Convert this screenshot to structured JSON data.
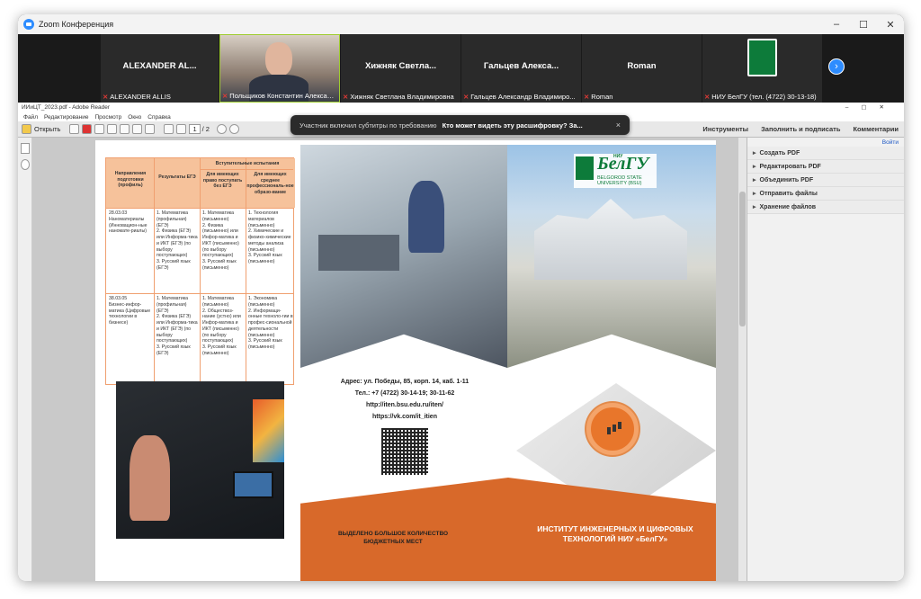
{
  "window": {
    "title": "Zoom Конференция",
    "controls": [
      "–",
      "☐",
      "✕"
    ]
  },
  "participants": [
    {
      "display": "ALEXANDER AL...",
      "caption": "ALEXANDER ALLIS",
      "muted": true
    },
    {
      "display": "",
      "caption": "Польщиков Константин Александр...",
      "muted": true,
      "active": true
    },
    {
      "display": "Хижняк Светла...",
      "caption": "Хижняк Светлана Владимировна",
      "muted": true
    },
    {
      "display": "Гальцев Алекса...",
      "caption": "Гальцев Александр Владимиро...",
      "muted": true
    },
    {
      "display": "Roman",
      "caption": "Roman",
      "muted": true
    },
    {
      "display": "",
      "caption": "НИУ БелГУ (тел. (4722) 30-13-18)",
      "muted": true
    }
  ],
  "toast": {
    "text": "Участник включил субтитры по требованию",
    "question": "Кто может видеть эту расшифровку? За...",
    "close": "×"
  },
  "reader": {
    "title": "ИИиЦТ_2023.pdf - Adobe Reader",
    "menu": [
      "Файл",
      "Редактирование",
      "Просмотр",
      "Окно",
      "Справка"
    ],
    "open_label": "Открыть",
    "page_current": "1",
    "page_total": "/ 2",
    "tools_right": [
      "Инструменты",
      "Заполнить и подписать",
      "Комментарии"
    ],
    "login": "Войти",
    "panel_items": [
      "Создать PDF",
      "Редактировать PDF",
      "Объединить PDF",
      "Отправить файлы",
      "Хранение файлов"
    ]
  },
  "brochure": {
    "table": {
      "h1": "Направления подготовки (профиль)",
      "h2": "Результаты ЕГЭ",
      "h3": "Вступительные испытания",
      "h4": "Для имеющих право поступать без ЕГЭ",
      "h5": "Для имеющих среднее профессиональ-ное образо-вание",
      "r1c1": "28.03.03\nНаноматериалы (Инновацион-ные наномате-риалы)",
      "r1c2": "1. Математика (профильная) (ЕГЭ)\n2. Физика (ЕГЭ) или Информа-тика и ИКТ (ЕГЭ) (по выбору поступающих)\n3. Русский язык (ЕГЭ)",
      "r1c3": "1. Математика (письменно)\n2. Физика (письменно) или Инфор-матика и ИКТ (письменно) (по выбору поступающих)\n3. Русский язык (письменно)",
      "r1c4": "1. Технология материалов (письменно)\n2. Химические и физико-химические методы анализа (письменно)\n3. Русский язык (письменно)",
      "r2c1": "38.03.05\nБизнес-инфор-матика (Цифровые технологии в бизнесе)",
      "r2c2": "1. Математика (профильная) (ЕГЭ)\n2. Физика (ЕГЭ) или Информа-тика и ИКТ (ЕГЭ) (по выбору поступающих)\n3. Русский язык (ЕГЭ)",
      "r2c3": "1. Математика (письменно)\n2. Обществоз-нание (устно) или Инфор-матика и ИКТ (письменно) (по выбору поступающих)\n3. Русский язык (письменно)",
      "r2c4": "1. Экономика (письменно)\n2. Информаци-онные техноло-гии в профес-сиональной деятельности (письменно)\n3. Русский язык (письменно)"
    },
    "logo_main": "БелГУ",
    "logo_niu": "НИУ",
    "logo_sub1": "BELGOROD STATE",
    "logo_sub2": "UNIVERSITY (BSU)",
    "address": "Адрес: ул. Победы, 85, корп. 14, каб. 1-11",
    "phone": "Тел.: +7 (4722) 30-14-19; 30-11-62",
    "site": "http://iten.bsu.edu.ru/iten/",
    "vk": "https://vk.com/it_itien",
    "budget": "ВЫДЕЛЕНО БОЛЬШОЕ КОЛИЧЕСТВО БЮДЖЕТНЫХ МЕСТ",
    "institute": "ИНСТИТУТ ИНЖЕНЕРНЫХ И ЦИФРОВЫХ ТЕХНОЛОГИЙ НИУ «БелГУ»"
  }
}
